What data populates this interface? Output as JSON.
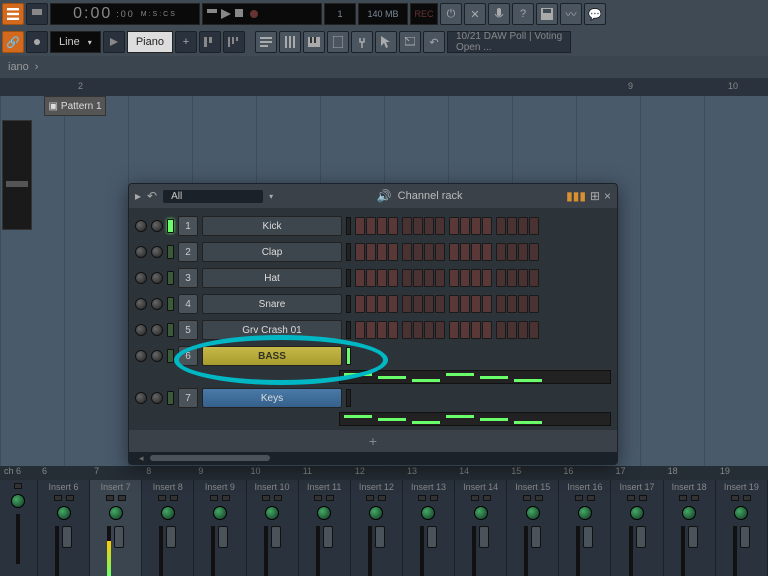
{
  "topbar": {
    "time": "0:00",
    "time_unit": "M:S:CS",
    "time_dec": ":00",
    "bar_pos": "1",
    "mem": "140 MB",
    "rec": "REC"
  },
  "toolbar2": {
    "snap": "Line",
    "pattern": "Piano",
    "news_line1": "10/21  DAW Poll | Voting",
    "news_line2": "Open ..."
  },
  "breadcrumb": {
    "path": "iano",
    "sep": "›"
  },
  "timeline": {
    "ticks": [
      "2",
      "9",
      "10"
    ],
    "pattern_clip": "Pattern 1"
  },
  "channel_rack": {
    "title": "Channel rack",
    "filter": "All",
    "channels": [
      {
        "num": "1",
        "name": "Kick",
        "style": "norm"
      },
      {
        "num": "2",
        "name": "Clap",
        "style": "norm"
      },
      {
        "num": "3",
        "name": "Hat",
        "style": "norm"
      },
      {
        "num": "4",
        "name": "Snare",
        "style": "norm"
      },
      {
        "num": "5",
        "name": "Grv Crash 01",
        "style": "norm"
      },
      {
        "num": "6",
        "name": "BASS",
        "style": "bass"
      },
      {
        "num": "7",
        "name": "Keys",
        "style": "keys"
      }
    ],
    "add": "+",
    "close": "×"
  },
  "mixer": {
    "ruler": [
      "6",
      "7",
      "8",
      "9",
      "10",
      "11",
      "12",
      "13",
      "14",
      "15",
      "16",
      "17",
      "18",
      "19"
    ],
    "left_label": "ch 6",
    "tracks": [
      "Insert 6",
      "Insert 7",
      "Insert 8",
      "Insert 9",
      "Insert 10",
      "Insert 11",
      "Insert 12",
      "Insert 13",
      "Insert 14",
      "Insert 15",
      "Insert 16",
      "Insert 17",
      "Insert 18",
      "Insert 19"
    ]
  },
  "icons": {
    "menu": "menu-icon",
    "power": "power-icon",
    "undo": "undo-icon",
    "hint": "hint-icon",
    "mic": "mic-icon",
    "help": "help-icon",
    "save": "save-icon",
    "wave": "wave-icon",
    "about": "about-icon",
    "link": "link-icon",
    "eye": "eye-icon",
    "play": "play-icon",
    "plus": "plus-icon",
    "speaker": "speaker-icon",
    "bars": "bars-icon"
  }
}
